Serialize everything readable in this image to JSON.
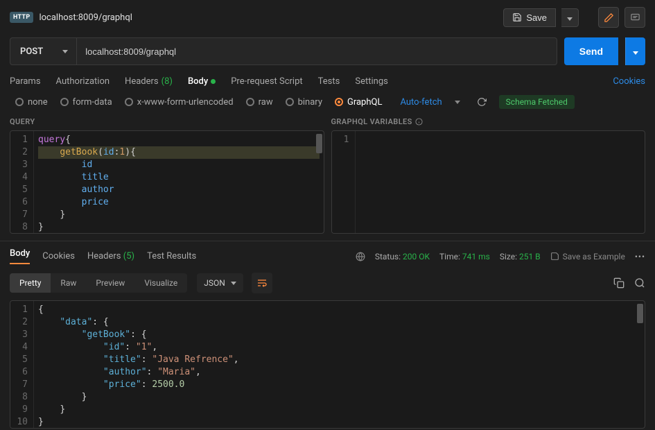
{
  "header": {
    "badge": "HTTP",
    "tab_title": "localhost:8009/graphql",
    "save": "Save"
  },
  "request": {
    "method": "POST",
    "url": "localhost:8009/graphql",
    "send": "Send"
  },
  "reqtabs": {
    "params": "Params",
    "authorization": "Authorization",
    "headers": "Headers",
    "headers_count": "(8)",
    "body": "Body",
    "prerequest": "Pre-request Script",
    "tests": "Tests",
    "settings": "Settings",
    "cookies": "Cookies"
  },
  "bodytype": {
    "none": "none",
    "formdata": "form-data",
    "xwww": "x-www-form-urlencoded",
    "raw": "raw",
    "binary": "binary",
    "graphql": "GraphQL",
    "autofetch": "Auto-fetch",
    "schema_fetched": "Schema Fetched"
  },
  "query_pane": {
    "header": "QUERY",
    "lines": [
      "1",
      "2",
      "3",
      "4",
      "5",
      "6",
      "7",
      "8"
    ],
    "code_html": "<span class='kw-q'>query</span><span class='kw-plain'>{</span>\n<span class='hl-line'>    <span class='kw-field'>getBook</span><span class='kw-plain'>(</span><span class='kw-arg'>id</span><span class='kw-plain'>:</span><span class='kw-num'>1</span><span class='kw-plain'>){</span></span>\n        <span class='kw-arg'>id</span>\n        <span class='kw-arg'>title</span>\n        <span class='kw-arg'>author</span>\n        <span class='kw-arg'>price</span>\n    <span class='kw-plain'>}</span>\n<span class='kw-plain'>}</span>"
  },
  "vars_pane": {
    "header": "GRAPHQL VARIABLES",
    "lines": [
      "1"
    ]
  },
  "resp_tabs": {
    "body": "Body",
    "cookies": "Cookies",
    "headers": "Headers",
    "headers_count": "(5)",
    "test_results": "Test Results"
  },
  "status": {
    "status_lbl": "Status:",
    "status_val": "200 OK",
    "time_lbl": "Time:",
    "time_val": "741 ms",
    "size_lbl": "Size:",
    "size_val": "251 B",
    "save_example": "Save as Example"
  },
  "viewmodes": {
    "pretty": "Pretty",
    "raw": "Raw",
    "preview": "Preview",
    "visualize": "Visualize",
    "type": "JSON"
  },
  "response": {
    "lines": [
      "1",
      "2",
      "3",
      "4",
      "5",
      "6",
      "7",
      "8",
      "9",
      "10"
    ],
    "code_html": "<span class='json-pun'>{</span>\n    <span class='json-key'>\"data\"</span><span class='json-pun'>: {</span>\n        <span class='json-key'>\"getBook\"</span><span class='json-pun'>: {</span>\n            <span class='json-key'>\"id\"</span><span class='json-pun'>: </span><span class='json-str'>\"1\"</span><span class='json-pun'>,</span>\n            <span class='json-key'>\"title\"</span><span class='json-pun'>: </span><span class='json-str'>\"Java Refrence\"</span><span class='json-pun'>,</span>\n            <span class='json-key'>\"author\"</span><span class='json-pun'>: </span><span class='json-str'>\"Maria\"</span><span class='json-pun'>,</span>\n            <span class='json-key'>\"price\"</span><span class='json-pun'>: </span><span class='json-num'>2500.0</span>\n        <span class='json-pun'>}</span>\n    <span class='json-pun'>}</span>\n<span class='json-pun'>}</span>"
  }
}
